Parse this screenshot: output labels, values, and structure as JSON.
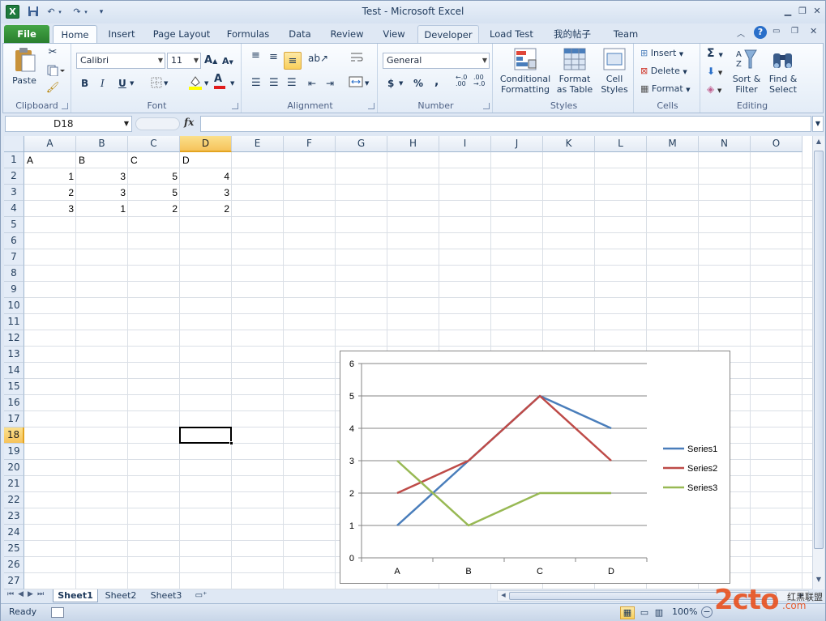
{
  "window": {
    "title": "Test - Microsoft Excel"
  },
  "ribbon_tabs": [
    "File",
    "Home",
    "Insert",
    "Page Layout",
    "Formulas",
    "Data",
    "Review",
    "View",
    "Developer",
    "Load Test",
    "我的帖子",
    "Team"
  ],
  "clipboard": {
    "paste": "Paste",
    "label": "Clipboard"
  },
  "font": {
    "name": "Calibri",
    "size": "11",
    "label": "Font"
  },
  "alignment": {
    "label": "Alignment"
  },
  "number": {
    "format": "General",
    "currency": "$",
    "percent": "%",
    "comma": ",",
    "inc_decimal": "←.0\n.00",
    "dec_decimal": ".00\n→.0",
    "label": "Number"
  },
  "styles": {
    "cond_fmt": "Conditional\nFormatting",
    "fmt_table": "Format\nas Table",
    "cell_styles": "Cell\nStyles",
    "label": "Styles"
  },
  "cells": {
    "insert": "Insert",
    "delete": "Delete",
    "format": "Format",
    "label": "Cells"
  },
  "editing": {
    "sort": "Sort &\nFilter",
    "find": "Find &\nSelect",
    "label": "Editing"
  },
  "formula_bar": {
    "name_box": "D18",
    "fx": "fx",
    "formula": ""
  },
  "columns": [
    "A",
    "B",
    "C",
    "D",
    "E",
    "F",
    "G",
    "H",
    "I",
    "J",
    "K",
    "L",
    "M",
    "N",
    "O"
  ],
  "active_col": "D",
  "rows": [
    "1",
    "2",
    "3",
    "4",
    "5",
    "6",
    "7",
    "8",
    "9",
    "10",
    "11",
    "12",
    "13",
    "14",
    "15",
    "16",
    "17",
    "18",
    "19",
    "20",
    "21",
    "22",
    "23",
    "24",
    "25",
    "26",
    "27"
  ],
  "active_row": "18",
  "sheet_cells": {
    "A1": "A",
    "B1": "B",
    "C1": "C",
    "D1": "D",
    "A2": "1",
    "B2": "3",
    "C2": "5",
    "D2": "4",
    "A3": "2",
    "B3": "3",
    "C3": "5",
    "D3": "3",
    "A4": "3",
    "B4": "1",
    "C4": "2",
    "D4": "2"
  },
  "sheet_tabs": [
    "Sheet1",
    "Sheet2",
    "Sheet3"
  ],
  "active_sheet": "Sheet1",
  "status": {
    "text": "Ready",
    "zoom": "100%"
  },
  "watermark": {
    "text": "2cto",
    "sub": ".com",
    "cn": "红黑联盟"
  },
  "chart_data": {
    "type": "line",
    "categories": [
      "A",
      "B",
      "C",
      "D"
    ],
    "series": [
      {
        "name": "Series1",
        "values": [
          1,
          3,
          5,
          4
        ],
        "color": "#4a7ebb"
      },
      {
        "name": "Series2",
        "values": [
          2,
          3,
          5,
          3
        ],
        "color": "#be4b48"
      },
      {
        "name": "Series3",
        "values": [
          3,
          1,
          2,
          2
        ],
        "color": "#98b954"
      }
    ],
    "ylim": [
      0,
      6
    ],
    "yticks": [
      "0",
      "1",
      "2",
      "3",
      "4",
      "5",
      "6"
    ],
    "grid": true,
    "legend": "right",
    "title": "",
    "xlabel": "",
    "ylabel": ""
  }
}
